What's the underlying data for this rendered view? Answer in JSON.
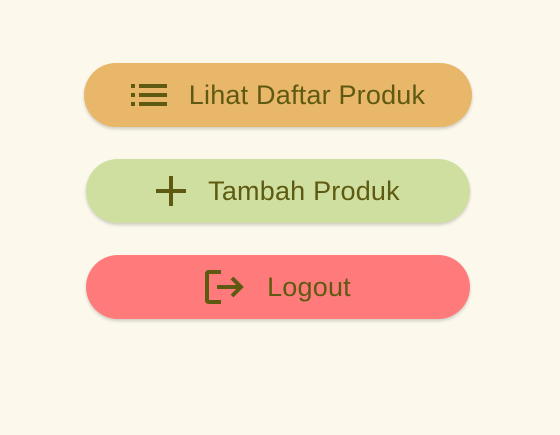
{
  "menu": {
    "items": [
      {
        "id": "list",
        "label": "Lihat Daftar Produk",
        "icon": "list-icon",
        "bg": "#e8b76a",
        "fg": "#5f5a12"
      },
      {
        "id": "add",
        "label": "Tambah Produk",
        "icon": "plus-icon",
        "bg": "#cfdf9f",
        "fg": "#5f5a12"
      },
      {
        "id": "logout",
        "label": "Logout",
        "icon": "logout-icon",
        "bg": "#ff7b7b",
        "fg": "#5f5a12"
      }
    ]
  }
}
